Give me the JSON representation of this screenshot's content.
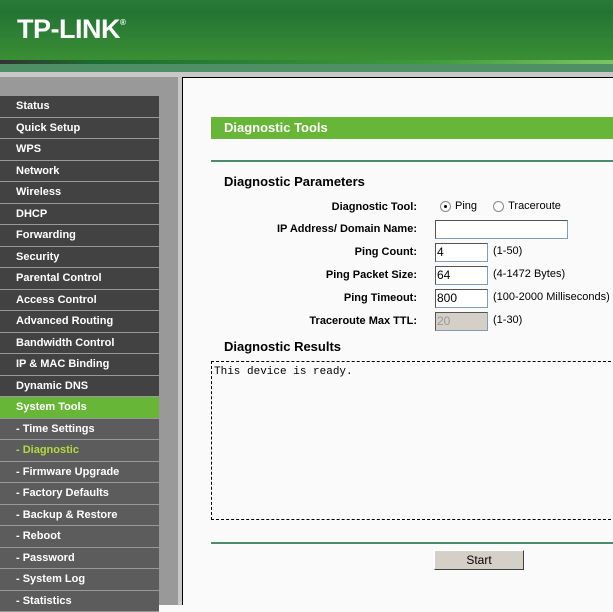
{
  "header": {
    "logo_text": "TP-LINK",
    "logo_mark": "®"
  },
  "sidebar": {
    "items": [
      {
        "label": "Status",
        "type": "main"
      },
      {
        "label": "Quick Setup",
        "type": "main"
      },
      {
        "label": "WPS",
        "type": "main"
      },
      {
        "label": "Network",
        "type": "main"
      },
      {
        "label": "Wireless",
        "type": "main"
      },
      {
        "label": "DHCP",
        "type": "main"
      },
      {
        "label": "Forwarding",
        "type": "main"
      },
      {
        "label": "Security",
        "type": "main"
      },
      {
        "label": "Parental Control",
        "type": "main"
      },
      {
        "label": "Access Control",
        "type": "main"
      },
      {
        "label": "Advanced Routing",
        "type": "main"
      },
      {
        "label": "Bandwidth Control",
        "type": "main"
      },
      {
        "label": "IP & MAC Binding",
        "type": "main"
      },
      {
        "label": "Dynamic DNS",
        "type": "main"
      },
      {
        "label": "System Tools",
        "type": "active"
      },
      {
        "label": "- Time Settings",
        "type": "sub"
      },
      {
        "label": "- Diagnostic",
        "type": "current"
      },
      {
        "label": "- Firmware Upgrade",
        "type": "sub"
      },
      {
        "label": "- Factory Defaults",
        "type": "sub"
      },
      {
        "label": "- Backup & Restore",
        "type": "sub"
      },
      {
        "label": "- Reboot",
        "type": "sub"
      },
      {
        "label": "- Password",
        "type": "sub"
      },
      {
        "label": "- System Log",
        "type": "sub"
      },
      {
        "label": "- Statistics",
        "type": "sub"
      }
    ]
  },
  "main": {
    "title": "Diagnostic Tools",
    "params_heading": "Diagnostic Parameters",
    "tool": {
      "label": "Diagnostic Tool:",
      "options": [
        "Ping",
        "Traceroute"
      ],
      "selected": "Ping"
    },
    "ip": {
      "label": "IP Address/ Domain Name:",
      "value": ""
    },
    "ping_count": {
      "label": "Ping Count:",
      "value": "4",
      "hint": "(1-50)"
    },
    "packet_size": {
      "label": "Ping Packet Size:",
      "value": "64",
      "hint": "(4-1472 Bytes)"
    },
    "timeout": {
      "label": "Ping Timeout:",
      "value": "800",
      "hint": "(100-2000 Milliseconds)"
    },
    "ttl": {
      "label": "Traceroute Max TTL:",
      "value": "20",
      "hint": "(1-30)"
    },
    "results_heading": "Diagnostic Results",
    "results_text": "This device is ready.",
    "start_label": "Start"
  }
}
